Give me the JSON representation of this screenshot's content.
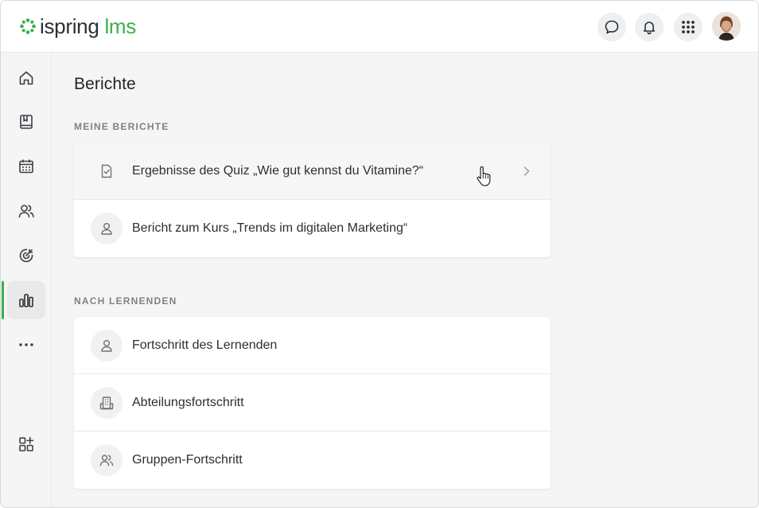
{
  "app": {
    "brand_main": "ispring",
    "brand_accent": "lms",
    "accent_color": "#3fae49"
  },
  "header": {
    "buttons": [
      {
        "name": "chat-icon"
      },
      {
        "name": "bell-icon"
      },
      {
        "name": "apps-grid-icon"
      }
    ],
    "avatar": "user-avatar"
  },
  "sidebar": {
    "items": [
      {
        "icon": "home-icon",
        "active": false
      },
      {
        "icon": "book-icon",
        "active": false
      },
      {
        "icon": "calendar-icon",
        "active": false
      },
      {
        "icon": "users-icon",
        "active": false
      },
      {
        "icon": "target-icon",
        "active": false
      },
      {
        "icon": "reports-chart-icon",
        "active": true
      },
      {
        "icon": "more-icon",
        "active": false
      }
    ],
    "bottom_item": {
      "icon": "add-widget-icon"
    }
  },
  "main": {
    "title": "Berichte",
    "sections": [
      {
        "label": "MEINE BERICHTE",
        "rows": [
          {
            "label": "Ergebnisse des Quiz „Wie gut kennst du Vitamine?“",
            "icon": "quiz-check-icon",
            "hover": true
          },
          {
            "label": "Bericht zum Kurs „Trends im digitalen Marketing“",
            "icon": "person-icon",
            "hover": false
          }
        ]
      },
      {
        "label": "NACH LERNENDEN",
        "rows": [
          {
            "label": "Fortschritt des Lernenden",
            "icon": "person-icon",
            "hover": false
          },
          {
            "label": "Abteilungsfortschritt",
            "icon": "building-icon",
            "hover": false
          },
          {
            "label": "Gruppen-Fortschritt",
            "icon": "group-icon",
            "hover": false
          }
        ]
      }
    ]
  }
}
